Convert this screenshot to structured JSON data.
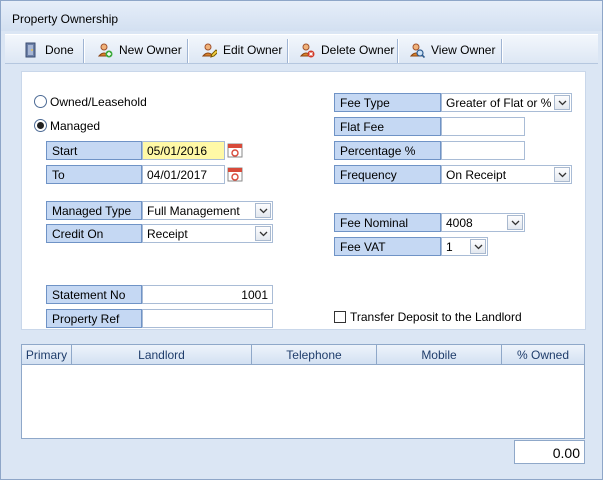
{
  "window": {
    "title": "Property Ownership"
  },
  "toolbar": {
    "done": "Done",
    "new_owner": "New Owner",
    "edit_owner": "Edit Owner",
    "delete_owner": "Delete Owner",
    "view_owner": "View Owner"
  },
  "ownership": {
    "owned_leasehold": "Owned/Leasehold",
    "managed": "Managed",
    "selected": "Managed"
  },
  "left": {
    "start_label": "Start",
    "start_value": "05/01/2016",
    "to_label": "To",
    "to_value": "04/01/2017",
    "managed_type_label": "Managed Type",
    "managed_type_value": "Full Management",
    "credit_on_label": "Credit On",
    "credit_on_value": "Receipt",
    "statement_no_label": "Statement No",
    "statement_no_value": "1001",
    "property_ref_label": "Property Ref",
    "property_ref_value": ""
  },
  "right": {
    "fee_type_label": "Fee Type",
    "fee_type_value": "Greater of Flat or %",
    "flat_fee_label": "Flat Fee",
    "flat_fee_value": "",
    "percentage_label": "Percentage %",
    "percentage_value": "",
    "frequency_label": "Frequency",
    "frequency_value": "On Receipt",
    "fee_nominal_label": "Fee Nominal",
    "fee_nominal_value": "4008",
    "fee_vat_label": "Fee VAT",
    "fee_vat_value": "1",
    "transfer_deposit_label": "Transfer Deposit to the Landlord",
    "transfer_deposit_checked": false
  },
  "grid": {
    "columns": [
      "Primary",
      "Landlord",
      "Telephone",
      "Mobile",
      "% Owned"
    ],
    "rows": []
  },
  "total": "0.00"
}
